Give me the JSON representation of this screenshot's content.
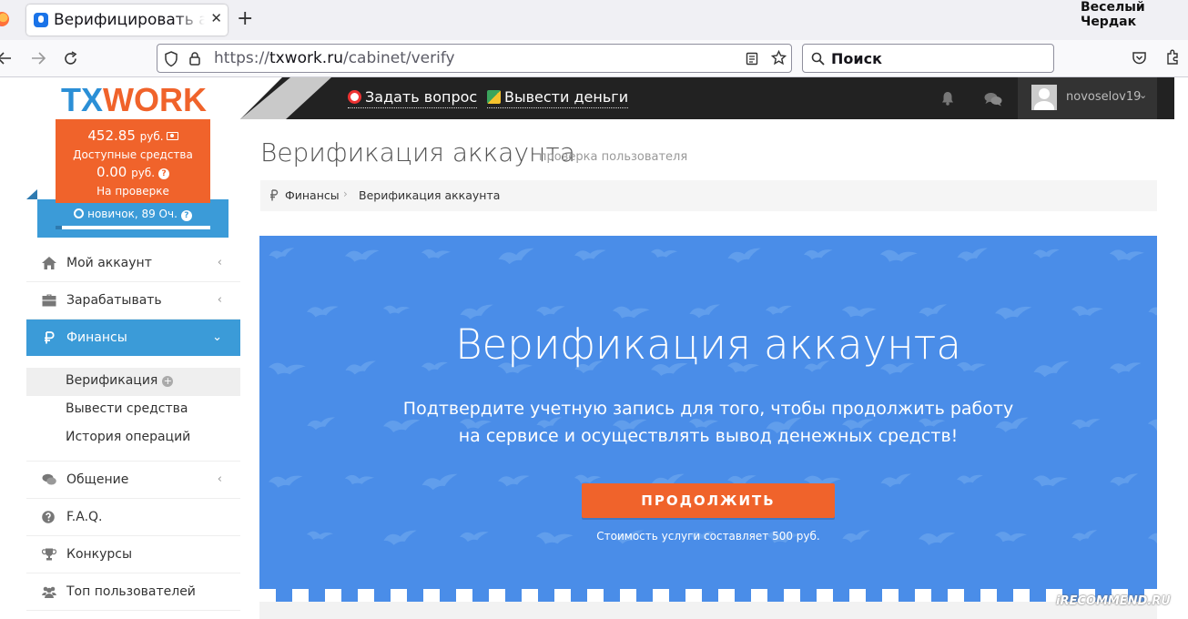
{
  "browser": {
    "tab_title": "Верифицировать аккаунт",
    "tab_close": "✕",
    "new_tab": "+",
    "window_caption": "Веселый Чердак",
    "url_scheme": "https://",
    "url_domain": "txwork.ru",
    "url_path": "/cabinet/verify",
    "search_placeholder": "Поиск"
  },
  "site": {
    "logo_part1": "TX",
    "logo_part2": "WORK",
    "top_links": [
      "Задать вопрос",
      "Вывести деньги"
    ],
    "username": "novoselov19"
  },
  "balance": {
    "available_amount": "452.85",
    "currency": "руб.",
    "available_label": "Доступные средства",
    "pending_amount": "0.00",
    "pending_label": "На проверке",
    "rank": "новичок, 89 Оч.",
    "rank_progress": 0.04
  },
  "menu": {
    "items": [
      {
        "label": "Мой аккаунт",
        "icon": "home-icon"
      },
      {
        "label": "Зарабатывать",
        "icon": "briefcase-icon"
      },
      {
        "label": "Финансы",
        "icon": "ruble-icon"
      },
      {
        "label": "Общение",
        "icon": "chat-icon"
      },
      {
        "label": "F.A.Q.",
        "icon": "question-icon"
      },
      {
        "label": "Конкурсы",
        "icon": "trophy-icon"
      },
      {
        "label": "Топ пользователей",
        "icon": "users-icon"
      }
    ],
    "finance_sub": [
      "Верификация",
      "Вывести средства",
      "История операций"
    ]
  },
  "page": {
    "title": "Верификация аккаунта",
    "subtitle": "проверка пользователя",
    "breadcrumb": [
      "Финансы",
      "Верификация аккаунта"
    ]
  },
  "banner": {
    "title": "Верификация аккаунта",
    "text": "Подтвердите учетную запись для того, чтобы продолжить работу на сервисе и осуществлять вывод денежных средств!",
    "button": "ПРОДОЛЖИТЬ",
    "cost_note": "Стоимость услуги составляет 500 руб."
  },
  "watermark": "iRECOMMEND.RU",
  "colors": {
    "accent_orange": "#f0632b",
    "accent_blue": "#3b9bd8",
    "banner_blue": "#4a8de8",
    "topbar_dark": "#222222"
  }
}
